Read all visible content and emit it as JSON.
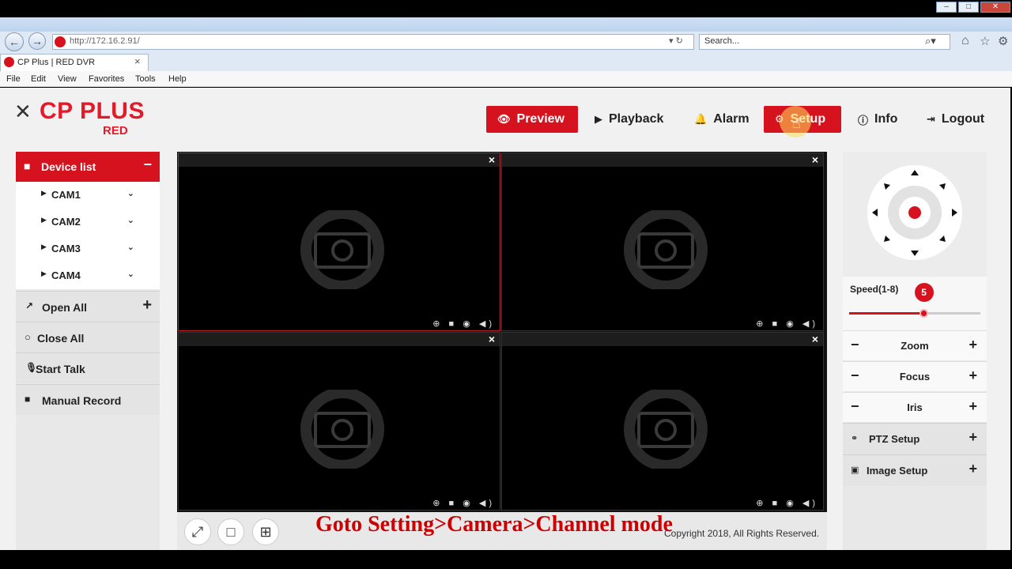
{
  "browser": {
    "address": "http://172.16.2.91/",
    "search_placeholder": "Search...",
    "tab_title": "CP Plus | RED DVR",
    "tab_close": "×",
    "menu": [
      "File",
      "Edit",
      "View",
      "Favorites",
      "Tools",
      "Help"
    ]
  },
  "logo": {
    "main": "CP PLUS",
    "sub": "RED"
  },
  "nav": {
    "preview": "Preview",
    "playback": "Playback",
    "alarm": "Alarm",
    "setup": "Setup",
    "info": "Info",
    "logout": "Logout"
  },
  "sidebar": {
    "device_list": "Device list",
    "collapse": "−",
    "cams": [
      "CAM1",
      "CAM2",
      "CAM3",
      "CAM4"
    ],
    "open_all": "Open All",
    "close_all": "Close All",
    "start_talk": "Start Talk",
    "manual_record": "Manual Record"
  },
  "video": {
    "close_glyph": "×",
    "controls": "⊕ ■ ◉ ◀)"
  },
  "footer": {
    "copyright": "Copyright 2018, All Rights Reserved.",
    "overlay": "Goto Setting>Camera>Channel mode"
  },
  "ptz": {
    "speed_label": "Speed(1-8)",
    "speed_value": "5",
    "speed_fraction": 0.57,
    "zoom": "Zoom",
    "focus": "Focus",
    "iris": "Iris",
    "minus": "−",
    "plus": "+",
    "ptz_setup": "PTZ Setup",
    "image_setup": "Image Setup"
  },
  "colors": {
    "accent": "#d7121f"
  }
}
